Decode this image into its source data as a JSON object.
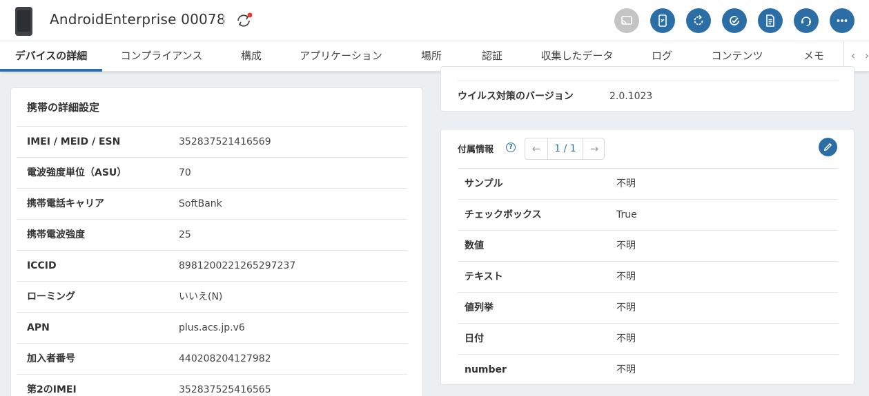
{
  "header": {
    "device_name": "AndroidEnterprise 00078",
    "icons": [
      "phone-icon",
      "sync-icon",
      "cast-icon",
      "remote-control-icon",
      "refresh-icon",
      "check-icon",
      "document-icon",
      "support-icon",
      "more-icon"
    ],
    "colors": {
      "accent": "#2b6ea6",
      "disabled": "#c4c4c4",
      "notification_dot": "#e53935"
    }
  },
  "tabs": [
    {
      "label": "デバイスの詳細"
    },
    {
      "label": "コンプライアンス"
    },
    {
      "label": "構成"
    },
    {
      "label": "アプリケーション"
    },
    {
      "label": "場所"
    },
    {
      "label": "認証"
    },
    {
      "label": "収集したデータ"
    },
    {
      "label": "ログ"
    },
    {
      "label": "コンテンツ"
    },
    {
      "label": "メモ"
    }
  ],
  "tab_nav": {
    "prev": "‹",
    "next": "›"
  },
  "mobile_details": {
    "title": "携帯の詳細設定",
    "rows": [
      {
        "label": "IMEI / MEID / ESN",
        "value": "352837521416569"
      },
      {
        "label": "電波強度単位（ASU）",
        "value": "70"
      },
      {
        "label": "携帯電話キャリア",
        "value": "SoftBank"
      },
      {
        "label": "携帯電波強度",
        "value": "25"
      },
      {
        "label": "ICCID",
        "value": "8981200221265297237"
      },
      {
        "label": "ローミング",
        "value": "いいえ(N)"
      },
      {
        "label": "APN",
        "value": "plus.acs.jp.v6"
      },
      {
        "label": "加入者番号",
        "value": "440208204127982"
      },
      {
        "label": "第2のIMEI",
        "value": "352837525416565"
      }
    ]
  },
  "antivirus": {
    "label": "ウイルス対策のバージョン",
    "value": "2.0.1023"
  },
  "custom_attributes": {
    "title": "付属情報",
    "help": "?",
    "pager": {
      "prev": "←",
      "text": "1 / 1",
      "next": "→"
    },
    "rows": [
      {
        "label": "サンプル",
        "value": "不明"
      },
      {
        "label": "チェックボックス",
        "value": "True"
      },
      {
        "label": "数値",
        "value": "不明"
      },
      {
        "label": "テキスト",
        "value": "不明"
      },
      {
        "label": "値列挙",
        "value": "不明"
      },
      {
        "label": "日付",
        "value": "不明"
      },
      {
        "label": "number",
        "value": "不明"
      }
    ]
  }
}
